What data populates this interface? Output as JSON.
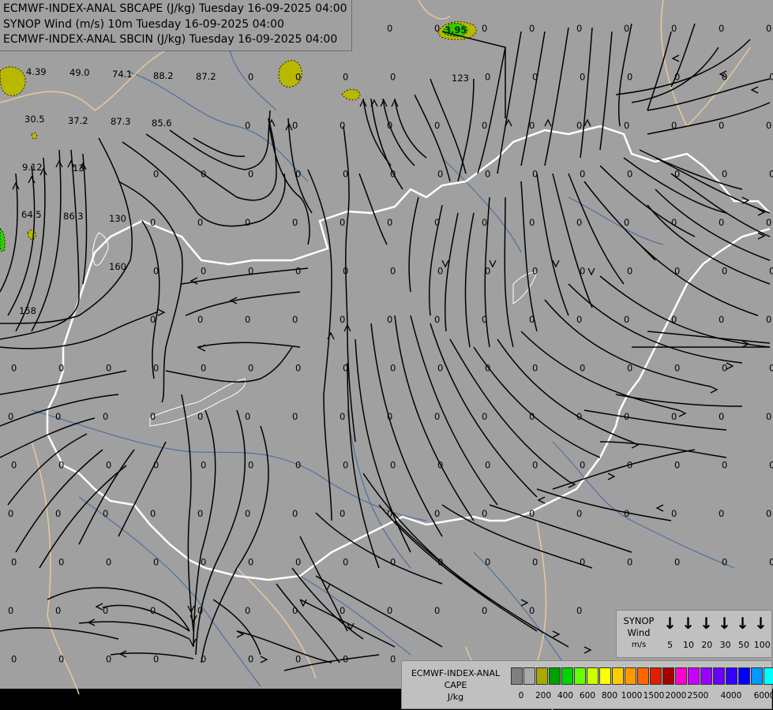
{
  "title_lines": [
    "ECMWF-INDEX-ANAL SBCAPE (J/kg) Tuesday 16-09-2025 04:00",
    "SYNOP Wind (m/s) 10m Tuesday 16-09-2025 04:00",
    "ECMWF-INDEX-ANAL SBCIN (J/kg) Tuesday 16-09-2025 04:00"
  ],
  "synop_legend": {
    "title_lines": [
      "SYNOP",
      "Wind",
      "m/s"
    ],
    "values": [
      "5",
      "10",
      "20",
      "30",
      "50",
      "100"
    ],
    "arrow_icon": "down-arrow-icon"
  },
  "cape_legend": {
    "title_lines": [
      "ECMWF-INDEX-ANAL",
      "CAPE",
      "J/kg"
    ],
    "colors": [
      "#7f7f7f",
      "#aaaaaa",
      "#a8a800",
      "#009f00",
      "#00d400",
      "#66ff00",
      "#ccff00",
      "#ffff00",
      "#ffcc00",
      "#ff9900",
      "#ff6600",
      "#e01e00",
      "#a80000",
      "#ff00cc",
      "#cc00ff",
      "#9900ff",
      "#6600ff",
      "#3300ff",
      "#0000ff",
      "#0099ff",
      "#00ffff",
      "#99ffff",
      "#ffffff"
    ],
    "ticks": [
      "0",
      "200",
      "400",
      "600",
      "800",
      "1000",
      "1500",
      "2000",
      "2500",
      "4000",
      "6000"
    ]
  },
  "cape_values": [
    "4.39",
    "49.0",
    "74.1",
    "88.2",
    "87.2",
    "30.5",
    "37.2",
    "87.3",
    "85.6",
    "123",
    "9.12",
    "13",
    "64.5",
    "86.3",
    "130",
    "160",
    "158",
    "3.95",
    "0"
  ],
  "map_colors": {
    "background": "#a0a0a0",
    "country_border": "#ffffff",
    "regional_border": "#e8c89a",
    "rivers": "#4f6fa0",
    "streamlines": "#000000",
    "cape_low": "#b8b800"
  }
}
